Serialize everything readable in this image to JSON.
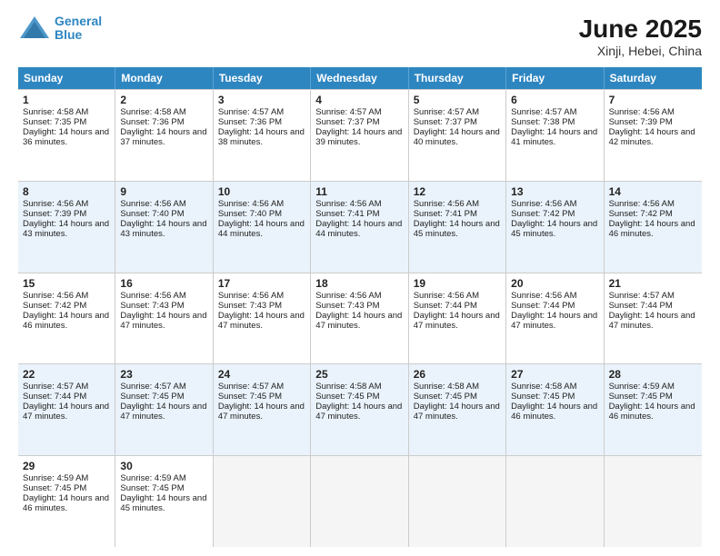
{
  "header": {
    "logo_line1": "General",
    "logo_line2": "Blue",
    "title": "June 2025",
    "subtitle": "Xinji, Hebei, China"
  },
  "days": [
    "Sunday",
    "Monday",
    "Tuesday",
    "Wednesday",
    "Thursday",
    "Friday",
    "Saturday"
  ],
  "rows": [
    [
      {
        "day": 1,
        "rise": "4:58 AM",
        "set": "7:35 PM",
        "daylight": "14 hours and 36 minutes."
      },
      {
        "day": 2,
        "rise": "4:58 AM",
        "set": "7:36 PM",
        "daylight": "14 hours and 37 minutes."
      },
      {
        "day": 3,
        "rise": "4:57 AM",
        "set": "7:36 PM",
        "daylight": "14 hours and 38 minutes."
      },
      {
        "day": 4,
        "rise": "4:57 AM",
        "set": "7:37 PM",
        "daylight": "14 hours and 39 minutes."
      },
      {
        "day": 5,
        "rise": "4:57 AM",
        "set": "7:37 PM",
        "daylight": "14 hours and 40 minutes."
      },
      {
        "day": 6,
        "rise": "4:57 AM",
        "set": "7:38 PM",
        "daylight": "14 hours and 41 minutes."
      },
      {
        "day": 7,
        "rise": "4:56 AM",
        "set": "7:39 PM",
        "daylight": "14 hours and 42 minutes."
      }
    ],
    [
      {
        "day": 8,
        "rise": "4:56 AM",
        "set": "7:39 PM",
        "daylight": "14 hours and 43 minutes."
      },
      {
        "day": 9,
        "rise": "4:56 AM",
        "set": "7:40 PM",
        "daylight": "14 hours and 43 minutes."
      },
      {
        "day": 10,
        "rise": "4:56 AM",
        "set": "7:40 PM",
        "daylight": "14 hours and 44 minutes."
      },
      {
        "day": 11,
        "rise": "4:56 AM",
        "set": "7:41 PM",
        "daylight": "14 hours and 44 minutes."
      },
      {
        "day": 12,
        "rise": "4:56 AM",
        "set": "7:41 PM",
        "daylight": "14 hours and 45 minutes."
      },
      {
        "day": 13,
        "rise": "4:56 AM",
        "set": "7:42 PM",
        "daylight": "14 hours and 45 minutes."
      },
      {
        "day": 14,
        "rise": "4:56 AM",
        "set": "7:42 PM",
        "daylight": "14 hours and 46 minutes."
      }
    ],
    [
      {
        "day": 15,
        "rise": "4:56 AM",
        "set": "7:42 PM",
        "daylight": "14 hours and 46 minutes."
      },
      {
        "day": 16,
        "rise": "4:56 AM",
        "set": "7:43 PM",
        "daylight": "14 hours and 47 minutes."
      },
      {
        "day": 17,
        "rise": "4:56 AM",
        "set": "7:43 PM",
        "daylight": "14 hours and 47 minutes."
      },
      {
        "day": 18,
        "rise": "4:56 AM",
        "set": "7:43 PM",
        "daylight": "14 hours and 47 minutes."
      },
      {
        "day": 19,
        "rise": "4:56 AM",
        "set": "7:44 PM",
        "daylight": "14 hours and 47 minutes."
      },
      {
        "day": 20,
        "rise": "4:56 AM",
        "set": "7:44 PM",
        "daylight": "14 hours and 47 minutes."
      },
      {
        "day": 21,
        "rise": "4:57 AM",
        "set": "7:44 PM",
        "daylight": "14 hours and 47 minutes."
      }
    ],
    [
      {
        "day": 22,
        "rise": "4:57 AM",
        "set": "7:44 PM",
        "daylight": "14 hours and 47 minutes."
      },
      {
        "day": 23,
        "rise": "4:57 AM",
        "set": "7:45 PM",
        "daylight": "14 hours and 47 minutes."
      },
      {
        "day": 24,
        "rise": "4:57 AM",
        "set": "7:45 PM",
        "daylight": "14 hours and 47 minutes."
      },
      {
        "day": 25,
        "rise": "4:58 AM",
        "set": "7:45 PM",
        "daylight": "14 hours and 47 minutes."
      },
      {
        "day": 26,
        "rise": "4:58 AM",
        "set": "7:45 PM",
        "daylight": "14 hours and 47 minutes."
      },
      {
        "day": 27,
        "rise": "4:58 AM",
        "set": "7:45 PM",
        "daylight": "14 hours and 46 minutes."
      },
      {
        "day": 28,
        "rise": "4:59 AM",
        "set": "7:45 PM",
        "daylight": "14 hours and 46 minutes."
      }
    ],
    [
      {
        "day": 29,
        "rise": "4:59 AM",
        "set": "7:45 PM",
        "daylight": "14 hours and 46 minutes."
      },
      {
        "day": 30,
        "rise": "4:59 AM",
        "set": "7:45 PM",
        "daylight": "14 hours and 45 minutes."
      },
      null,
      null,
      null,
      null,
      null
    ]
  ]
}
